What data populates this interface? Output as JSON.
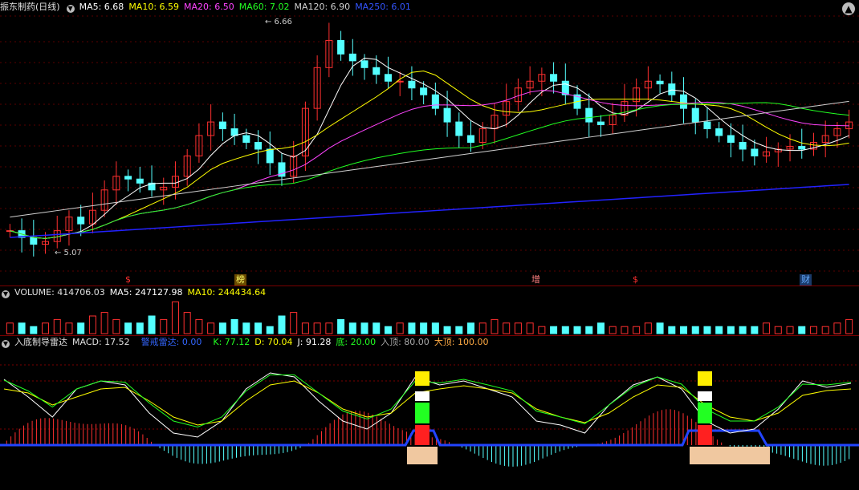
{
  "header": {
    "title": "振东制药(日线)",
    "ma5": "MA5: 6.68",
    "ma10": "MA10: 6.59",
    "ma20": "MA20: 6.50",
    "ma60": "MA60: 7.02",
    "ma120": "MA120: 6.90",
    "ma250": "MA250: 6.01"
  },
  "price_annotations": {
    "high": "6.66",
    "low": "5.07"
  },
  "event_tags": [
    {
      "label": "$",
      "color": "#ff3030"
    },
    {
      "label": "榜",
      "color": "#ffff66"
    },
    {
      "label": "增",
      "color": "#ff8080"
    },
    {
      "label": "$",
      "color": "#ff3030"
    },
    {
      "label": "财",
      "color": "#66aaff"
    }
  ],
  "volume_header": {
    "volume": "VOLUME: 414706.03",
    "ma5": "MA5: 247127.98",
    "ma10": "MA10: 244434.64"
  },
  "indicator_header": {
    "name": "入底制导雷达",
    "macd": "MACD: 17.52",
    "alert": "警戒雷达: 0.00",
    "k": "K: 77.12",
    "d": "D: 70.04",
    "j": "J: 91.28",
    "bottom": "底: 20.00",
    "top_in": "入顶: 80.00",
    "top": "大顶: 100.00"
  },
  "colors": {
    "up": "#ff3030",
    "down": "#54ffff",
    "ma5": "#ffffff",
    "ma10": "#ffff00",
    "ma20": "#ff44ff",
    "ma60": "#22ff22",
    "ma120": "#d0d0d0",
    "ma250": "#2222ff"
  },
  "chart_data": [
    {
      "type": "candlestick",
      "title": "振东制药(日线)",
      "yrange": [
        5.07,
        6.66
      ],
      "series_close_sketch": [
        5.2,
        5.15,
        5.1,
        5.12,
        5.2,
        5.3,
        5.25,
        5.35,
        5.5,
        5.6,
        5.58,
        5.55,
        5.5,
        5.52,
        5.6,
        5.75,
        5.9,
        6.0,
        5.95,
        5.9,
        5.85,
        5.8,
        5.7,
        5.6,
        5.75,
        6.1,
        6.4,
        6.6,
        6.5,
        6.45,
        6.4,
        6.35,
        6.3,
        6.3,
        6.25,
        6.2,
        6.1,
        6.0,
        5.9,
        5.85,
        5.95,
        6.05,
        6.15,
        6.25,
        6.3,
        6.35,
        6.3,
        6.2,
        6.1,
        6.0,
        5.98,
        6.05,
        6.15,
        6.25,
        6.3,
        6.28,
        6.2,
        6.1,
        6.0,
        5.95,
        5.9,
        5.85,
        5.8,
        5.75,
        5.78,
        5.8,
        5.82,
        5.8,
        5.85,
        5.9,
        5.95,
        6.0
      ]
    },
    {
      "type": "bar",
      "title": "VOLUME",
      "values_sketch": [
        3,
        3,
        2,
        3,
        4,
        3,
        3,
        5,
        6,
        4,
        3,
        3,
        5,
        4,
        9,
        6,
        4,
        3,
        3,
        4,
        3,
        3,
        2,
        5,
        6,
        3,
        3,
        3,
        4,
        3,
        3,
        3,
        2,
        3,
        3,
        3,
        3,
        2,
        2,
        3,
        3,
        4,
        3,
        3,
        3,
        2,
        2,
        2,
        2,
        2,
        3,
        2,
        2,
        2,
        3,
        3,
        2,
        2,
        2,
        2,
        2,
        2,
        2,
        2,
        3,
        2,
        2,
        2,
        2,
        2,
        3,
        4
      ]
    },
    {
      "type": "line",
      "title": "入底制导雷达",
      "series": [
        {
          "name": "K",
          "values": [
            82,
            60,
            35,
            70,
            80,
            75,
            40,
            15,
            10,
            30,
            70,
            90,
            85,
            55,
            30,
            20,
            40,
            85,
            75,
            80,
            70,
            60,
            30,
            25,
            15,
            50,
            75,
            85,
            70,
            30,
            15,
            20,
            45,
            80,
            72,
            77
          ]
        },
        {
          "name": "D",
          "values": [
            70,
            65,
            50,
            60,
            70,
            72,
            55,
            35,
            25,
            30,
            55,
            75,
            80,
            65,
            45,
            35,
            40,
            65,
            70,
            74,
            70,
            65,
            45,
            35,
            28,
            40,
            60,
            75,
            72,
            50,
            35,
            30,
            40,
            62,
            68,
            70
          ]
        }
      ],
      "reference_levels": [
        20,
        80,
        100
      ]
    }
  ]
}
